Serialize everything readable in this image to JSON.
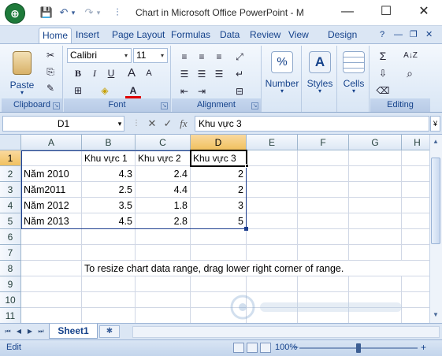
{
  "window": {
    "office_button": "⊕",
    "title": "Chart in Microsoft Office PowerPoint - M",
    "minimize": "—",
    "maximize": "☐",
    "close": "✕"
  },
  "qat": {
    "save": "💾",
    "undo": "↶",
    "undo_drop": "▾",
    "redo": "↷",
    "redo_drop": "▾",
    "customize": "⫶"
  },
  "tabs": [
    "Home",
    "Insert",
    "Page Layout",
    "Formulas",
    "Data",
    "Review",
    "View",
    "Design"
  ],
  "tab_icons": {
    "help": "?",
    "min": "—",
    "restore": "❐",
    "close": "✕"
  },
  "ribbon": {
    "clipboard": {
      "label": "Clipboard",
      "paste": "Paste",
      "paste_drop": "▾",
      "cut": "✂",
      "copy": "⎘",
      "format_painter": "✎"
    },
    "font": {
      "label": "Font",
      "name": "Calibri",
      "size": "11",
      "grow": "A",
      "shrink": "A",
      "bold": "B",
      "italic": "I",
      "underline": "U",
      "border": "⊞",
      "fill": "◈",
      "color": "A"
    },
    "alignment": {
      "label": "Alignment"
    },
    "number": {
      "label": "Number",
      "icon": "%"
    },
    "styles": {
      "label": "Styles",
      "icon": "A"
    },
    "cells": {
      "label": "Cells"
    },
    "editing": {
      "label": "Editing",
      "sum": "Σ",
      "sort": "A↓Z",
      "fill": "⇩",
      "find": "⌕",
      "clear": "⌫"
    }
  },
  "formula_bar": {
    "name_box": "D1",
    "name_drop": "▾",
    "cancel": "✕",
    "enter": "✓",
    "fx": "fx",
    "value": "Khu vực 3",
    "expand": "¥"
  },
  "grid": {
    "columns": [
      "A",
      "B",
      "C",
      "D",
      "E",
      "F",
      "G",
      "H"
    ],
    "rows": [
      "1",
      "2",
      "3",
      "4",
      "5",
      "6",
      "7",
      "8",
      "9",
      "10",
      "11"
    ],
    "headers": [
      "",
      "Khu vực 1",
      "Khu vực 2",
      "Khu vực 3"
    ],
    "data": [
      [
        "Năm 2010",
        "4.3",
        "2.4",
        "2"
      ],
      [
        "Năm2011",
        "2.5",
        "4.4",
        "2"
      ],
      [
        "Năm 2012",
        "3.5",
        "1.8",
        "3"
      ],
      [
        "Năm 2013",
        "4.5",
        "2.8",
        "5"
      ]
    ],
    "note": "To resize chart data range, drag lower right corner of range."
  },
  "sheets": {
    "nav_first": "⏮",
    "nav_prev": "◀",
    "nav_next": "▶",
    "nav_last": "⏭",
    "sheet1": "Sheet1",
    "new_sheet": "✱"
  },
  "status": {
    "mode": "Edit",
    "zoom": "100%",
    "zoom_minus": "−",
    "zoom_plus": "+"
  },
  "colors": {
    "accent": "#15428b",
    "selection": "#f1c15f",
    "data_range": "#1f3f8f"
  }
}
